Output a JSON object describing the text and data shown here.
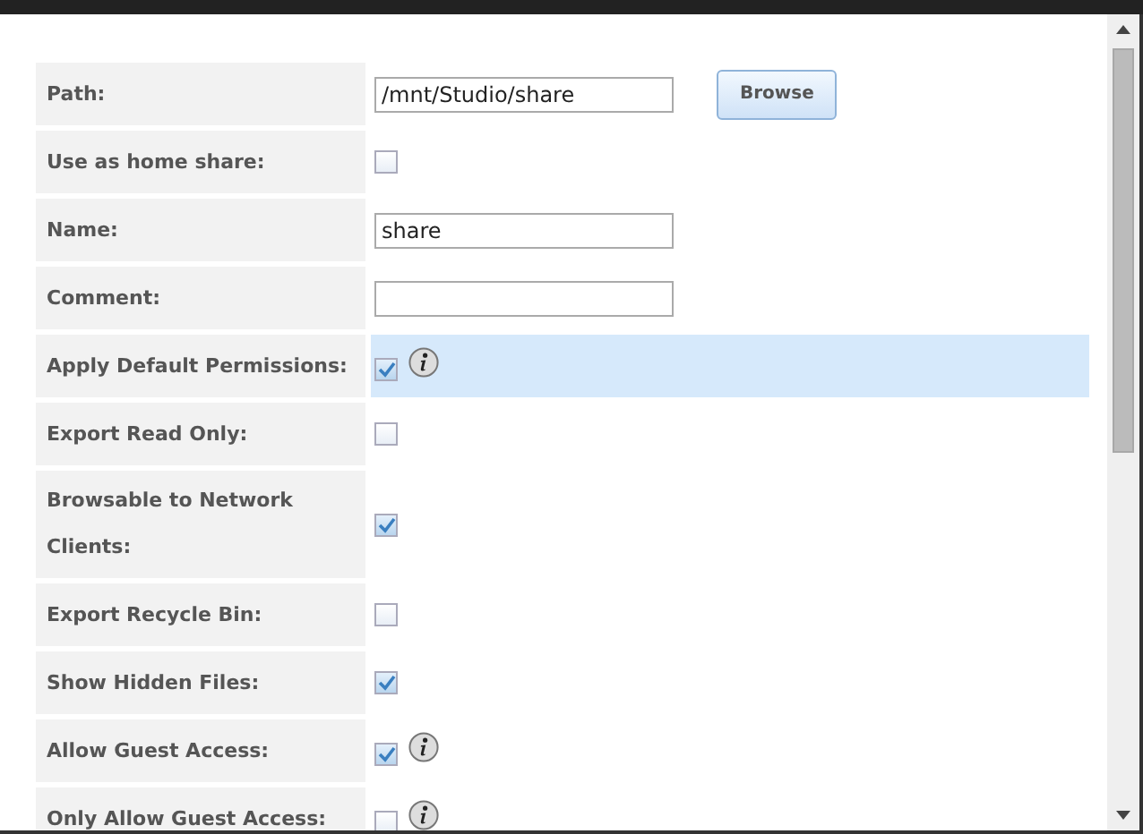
{
  "rows": [
    {
      "label": "Path:",
      "kind": "text",
      "value": "/mnt/Studio/share",
      "button": "Browse"
    },
    {
      "label": "Use as home share:",
      "kind": "checkbox",
      "checked": false
    },
    {
      "label": "Name:",
      "kind": "text",
      "value": "share"
    },
    {
      "label": "Comment:",
      "kind": "text"
    },
    {
      "label": "Apply Default Permissions:",
      "kind": "checkbox",
      "checked": true,
      "info": true,
      "highlighted": true
    },
    {
      "label": "Export Read Only:",
      "kind": "checkbox",
      "checked": false
    },
    {
      "label": "Browsable to Network Clients:",
      "kind": "checkbox",
      "checked": true
    },
    {
      "label": "Export Recycle Bin:",
      "kind": "checkbox",
      "checked": false
    },
    {
      "label": "Show Hidden Files:",
      "kind": "checkbox",
      "checked": true
    },
    {
      "label": "Allow Guest Access:",
      "kind": "checkbox",
      "checked": true,
      "info": true
    },
    {
      "label": "Only Allow Guest Access:",
      "kind": "checkbox",
      "checked": false,
      "info": true
    }
  ]
}
